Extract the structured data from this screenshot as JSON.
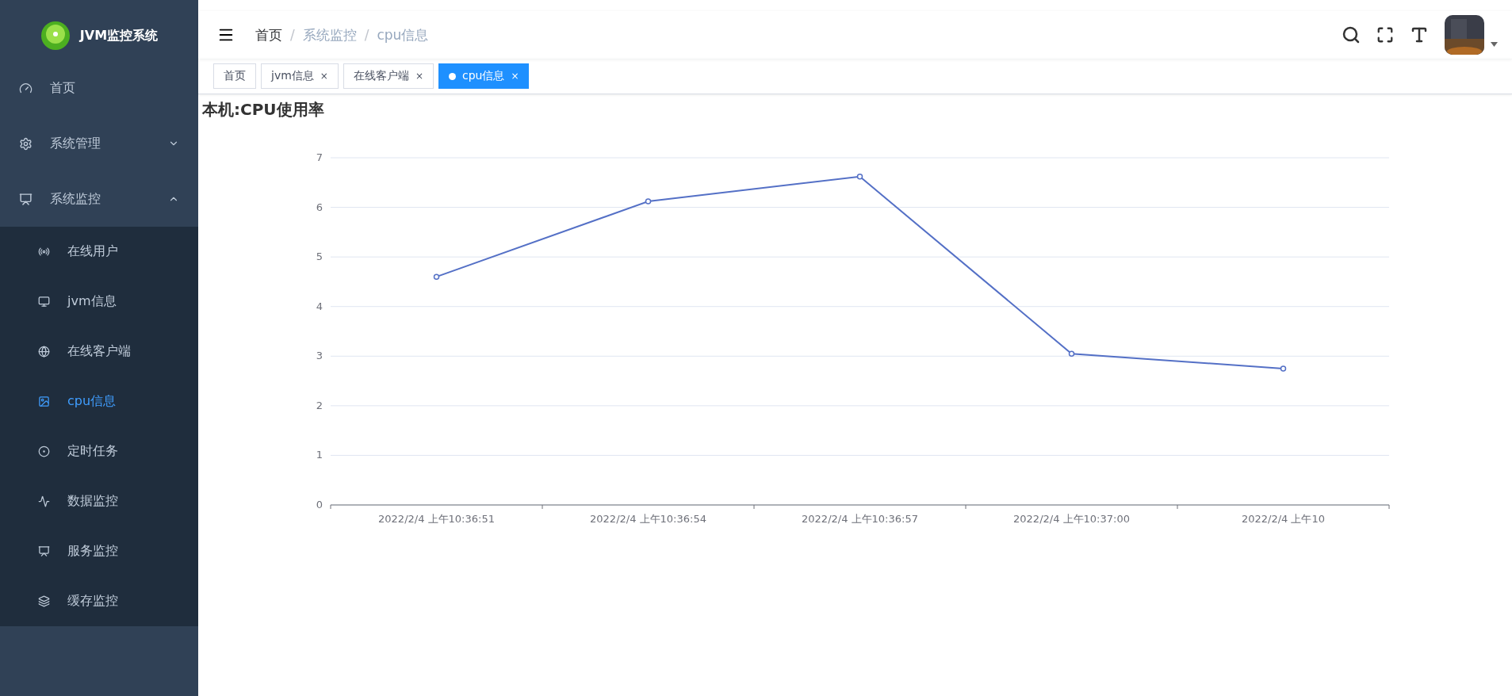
{
  "sidebar": {
    "logo_text": "JVM监控系统",
    "items": [
      {
        "label": "首页"
      },
      {
        "label": "系统管理",
        "expanded": false
      },
      {
        "label": "系统监控",
        "expanded": true,
        "children": [
          {
            "label": "在线用户",
            "selected": false
          },
          {
            "label": "jvm信息",
            "selected": false
          },
          {
            "label": "在线客户端",
            "selected": false
          },
          {
            "label": "cpu信息",
            "selected": true
          },
          {
            "label": "定时任务",
            "selected": false
          },
          {
            "label": "数据监控",
            "selected": false
          },
          {
            "label": "服务监控",
            "selected": false
          },
          {
            "label": "缓存监控",
            "selected": false
          }
        ]
      }
    ]
  },
  "breadcrumb": [
    {
      "label": "首页",
      "link": true
    },
    {
      "separator": "/",
      "label": "系统监控",
      "link": false
    },
    {
      "separator": "/",
      "label": "cpu信息",
      "link": false
    }
  ],
  "tags": [
    {
      "label": "首页",
      "selected": false
    },
    {
      "label": "jvm信息",
      "selected": false,
      "close": "×"
    },
    {
      "label": "在线客户端",
      "selected": false,
      "close": "×"
    },
    {
      "label": "cpu信息",
      "selected": true,
      "close": "×"
    }
  ],
  "content": {
    "title": "本机:CPU使用率",
    "chart_data": {
      "type": "line",
      "grid": true,
      "categories": [
        "2022/2/4 上午10:36:51",
        "2022/2/4 上午10:36:54",
        "2022/2/4 上午10:36:57",
        "2022/2/4 上午10:37:00",
        "2022/2/4 上午10"
      ],
      "series": [
        {
          "color": "#5470c6",
          "marker": "circle",
          "values": [
            4.6,
            6.12,
            6.62,
            3.05,
            2.75
          ]
        }
      ],
      "ylim": [
        0,
        7
      ],
      "yticks": [
        0,
        1,
        2,
        3,
        4,
        5,
        6,
        7
      ]
    }
  }
}
